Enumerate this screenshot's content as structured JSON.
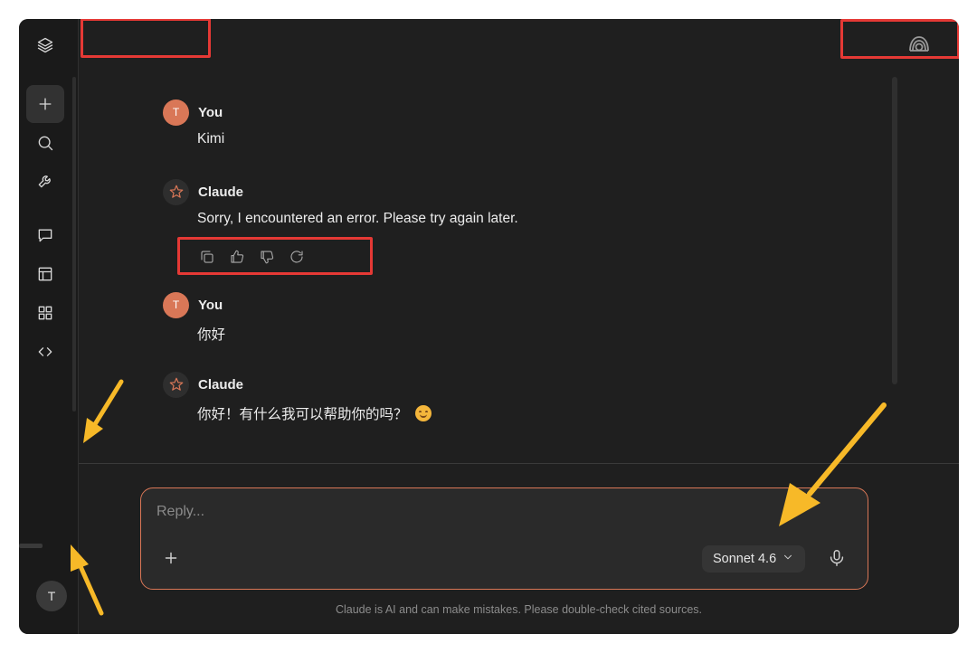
{
  "sidebar": {
    "icons": [
      "layers-logo-icon",
      "new-chat-icon",
      "search-icon",
      "tools-icon",
      "chats-icon",
      "projects-icon",
      "artifacts-icon",
      "code-icon"
    ],
    "avatar_initial": "T"
  },
  "messages": [
    {
      "role": "user",
      "sender": "You",
      "avatar": "T",
      "text": "Kimi"
    },
    {
      "role": "assistant",
      "sender": "Claude",
      "text": "Sorry, I encountered an error. Please try again later."
    },
    {
      "role": "user",
      "sender": "You",
      "avatar": "T",
      "text": "你好"
    },
    {
      "role": "assistant",
      "sender": "Claude",
      "text": "你好！有什么我可以帮助你的吗？"
    }
  ],
  "message_actions": [
    "copy-icon",
    "thumbs-up-icon",
    "thumbs-down-icon",
    "retry-icon"
  ],
  "composer": {
    "placeholder": "Reply...",
    "model_label": "Sonnet 4.6"
  },
  "disclaimer": "Claude is AI and can make mistakes. Please double-check cited sources.",
  "colors": {
    "accent": "#d97757",
    "annotation_red": "#e53935",
    "annotation_yellow": "#f7b928",
    "background": "#1f1f1f"
  }
}
